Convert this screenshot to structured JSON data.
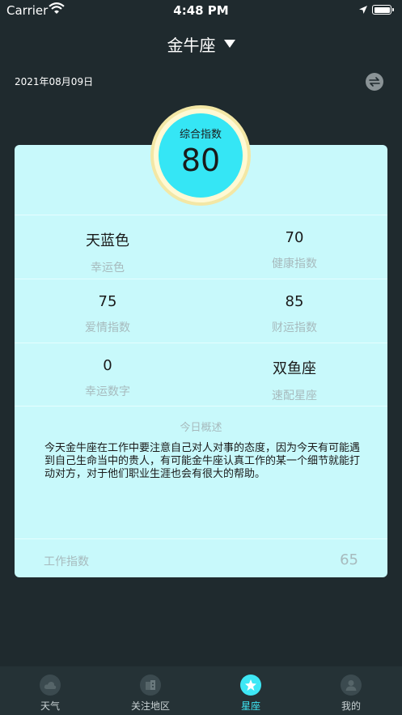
{
  "status_bar": {
    "carrier": "Carrier",
    "time": "4:48 PM"
  },
  "header": {
    "title": "金牛座"
  },
  "date": "2021年08月09日",
  "score": {
    "label": "综合指数",
    "value": "80"
  },
  "stats": [
    {
      "value": "天蓝色",
      "label": "幸运色"
    },
    {
      "value": "70",
      "label": "健康指数"
    },
    {
      "value": "75",
      "label": "爱情指数"
    },
    {
      "value": "85",
      "label": "财运指数"
    },
    {
      "value": "0",
      "label": "幸运数字"
    },
    {
      "value": "双鱼座",
      "label": "速配星座"
    }
  ],
  "overview": {
    "title": "今日概述",
    "text": "今天金牛座在工作中要注意自己对人对事的态度，因为今天有可能遇到自己生命当中的贵人，有可能金牛座认真工作的某一个细节就能打动对方，对于他们职业生涯也会有很大的帮助。"
  },
  "work": {
    "label": "工作指数",
    "value": "65"
  },
  "tabs": [
    {
      "label": "天气",
      "icon": "cloud-icon"
    },
    {
      "label": "关注地区",
      "icon": "building-icon"
    },
    {
      "label": "星座",
      "icon": "star-icon",
      "active": true
    },
    {
      "label": "我的",
      "icon": "user-icon"
    }
  ],
  "colors": {
    "accent": "#3ee7f5",
    "card": "#c8f9fb",
    "background": "#1f2a2e"
  }
}
